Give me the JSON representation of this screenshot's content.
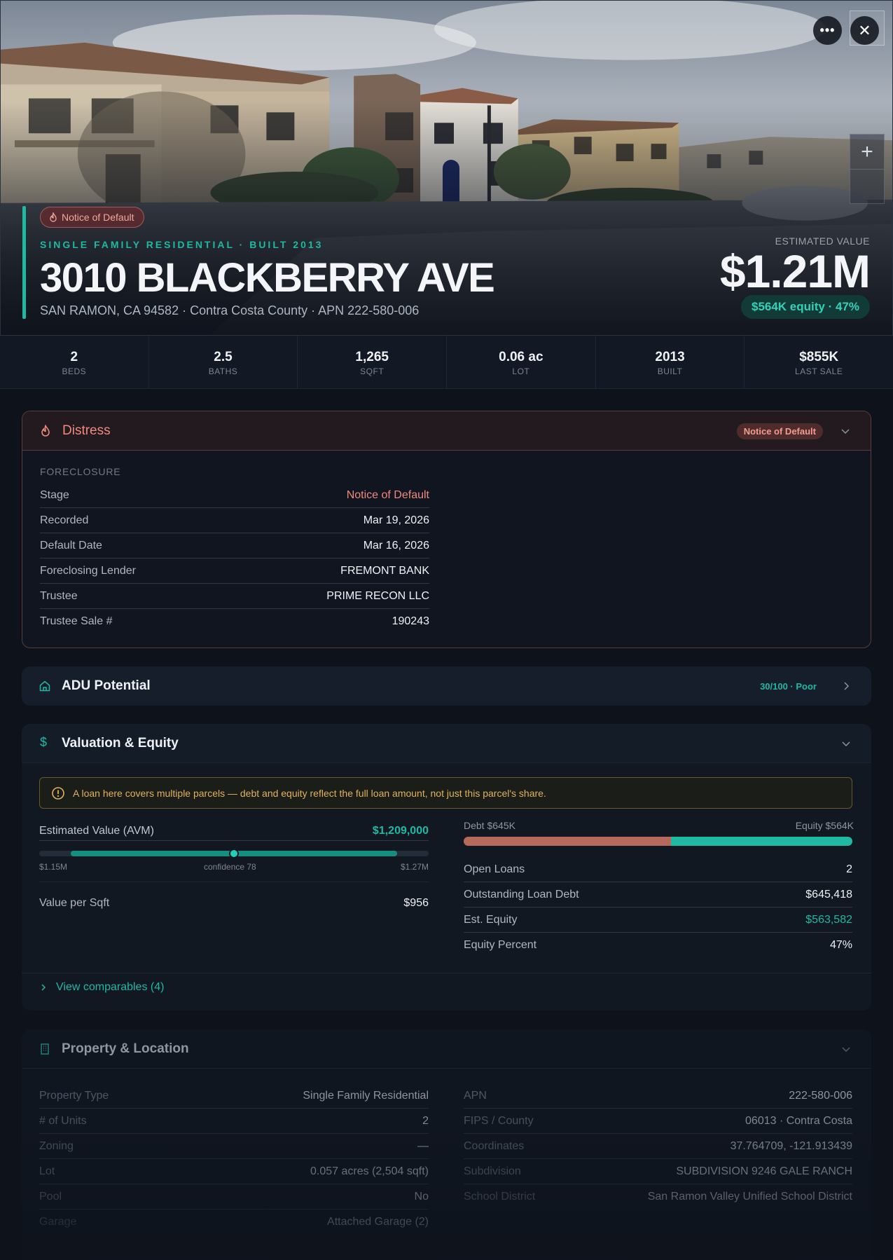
{
  "hero": {
    "status_badge": "Notice of Default",
    "kicker": "SINGLE FAMILY RESIDENTIAL · BUILT 2013",
    "address": "3010 BLACKBERRY AVE",
    "subtitle": "SAN RAMON, CA 94582 · Contra Costa County · APN 222-580-006",
    "estimated_value_label": "ESTIMATED VALUE",
    "estimated_value": "$1.21M",
    "equity_pill": "$564K equity · 47%",
    "more_icon": "more-horizontal-icon",
    "close_icon": "close-icon",
    "zoom_in_icon": "plus-icon",
    "more_glyph": "•••",
    "close_glyph": "✕",
    "zoom_glyph": "+"
  },
  "stats": [
    {
      "value": "2",
      "label": "BEDS"
    },
    {
      "value": "2.5",
      "label": "BATHS"
    },
    {
      "value": "1,265",
      "label": "SQFT"
    },
    {
      "value": "0.06 ac",
      "label": "LOT"
    },
    {
      "value": "2013",
      "label": "BUILT"
    },
    {
      "value": "$855K",
      "label": "LAST SALE"
    }
  ],
  "distress": {
    "title": "Distress",
    "badge": "Notice of Default",
    "section_label": "FORECLOSURE",
    "rows": [
      {
        "key": "Stage",
        "value": "Notice of Default"
      },
      {
        "key": "Recorded",
        "value": "Mar 19, 2026"
      },
      {
        "key": "Default Date",
        "value": "Mar 16, 2026"
      },
      {
        "key": "Foreclosing Lender",
        "value": "FREMONT BANK"
      },
      {
        "key": "Trustee",
        "value": "PRIME RECON LLC"
      },
      {
        "key": "Trustee Sale #",
        "value": "190243"
      }
    ]
  },
  "adu": {
    "title": "ADU Potential",
    "score": "30/100 · Poor"
  },
  "valuation": {
    "title": "Valuation & Equity",
    "alert": "A loan here covers multiple parcels — debt and equity reflect the full loan amount, not just this parcel's share.",
    "avm_label": "Estimated Value (AVM)",
    "avm_value": "$1,209,000",
    "range_low": "$1.15M",
    "range_high": "$1.27M",
    "confidence": "confidence 78",
    "value_per_sqft_label": "Value per Sqft",
    "value_per_sqft": "$956",
    "debt_label": "Debt $645K",
    "equity_label": "Equity $564K",
    "debt_fraction": 0.534,
    "rows": [
      {
        "key": "Open Loans",
        "value": "2"
      },
      {
        "key": "Outstanding Loan Debt",
        "value": "$645,418"
      },
      {
        "key": "Est. Equity",
        "value": "$563,582"
      },
      {
        "key": "Equity Percent",
        "value": "47%"
      }
    ],
    "comparables_link": "View comparables (4)"
  },
  "property": {
    "title": "Property & Location",
    "left_rows": [
      {
        "key": "Property Type",
        "value": "Single Family Residential"
      },
      {
        "key": "# of Units",
        "value": "2"
      },
      {
        "key": "Zoning",
        "value": "—"
      },
      {
        "key": "Lot",
        "value": "0.057 acres (2,504 sqft)"
      },
      {
        "key": "Pool",
        "value": "No"
      },
      {
        "key": "Garage",
        "value": "Attached Garage (2)"
      }
    ],
    "right_rows": [
      {
        "key": "APN",
        "value": "222-580-006"
      },
      {
        "key": "FIPS / County",
        "value": "06013 · Contra Costa"
      },
      {
        "key": "Coordinates",
        "value": "37.764709, -121.913439"
      },
      {
        "key": "Subdivision",
        "value": "SUBDIVISION 9246 GALE RANCH"
      },
      {
        "key": "School District",
        "value": "San Ramon Valley Unified School District"
      }
    ]
  },
  "colors": {
    "accent": "#1fb8a3",
    "distress": "#ef8a7c",
    "debt": "#b66a5b",
    "background": "#0d121b"
  }
}
